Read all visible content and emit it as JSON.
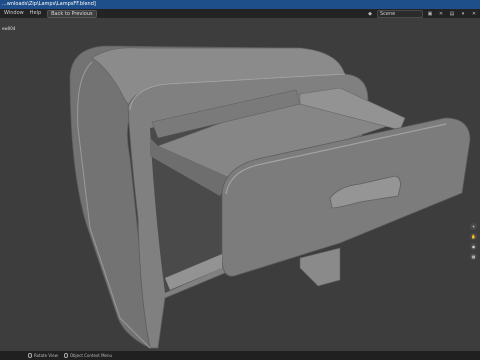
{
  "window": {
    "title": "...wnloads\\Zip\\Lamps\\LampsFF.blend]"
  },
  "menu": {
    "items": [
      "Window",
      "Help"
    ],
    "back_label": "Back to Previous"
  },
  "header_right": {
    "scene_label": "Scene",
    "icons": [
      "scene-icon",
      "new-scene-icon",
      "delete-icon",
      "view-layer-icon",
      "browse-icon",
      "close-icon"
    ]
  },
  "viewport": {
    "label": "ew004",
    "background": "#3d3d3d",
    "model_color": "#7f7f7f"
  },
  "statusbar": {
    "items": [
      {
        "label": "Rotate View"
      },
      {
        "label": "Object Context Menu"
      }
    ]
  },
  "colors": {
    "title_bar": "#1f4f8a",
    "header": "#232323",
    "status_bar": "#202020"
  }
}
